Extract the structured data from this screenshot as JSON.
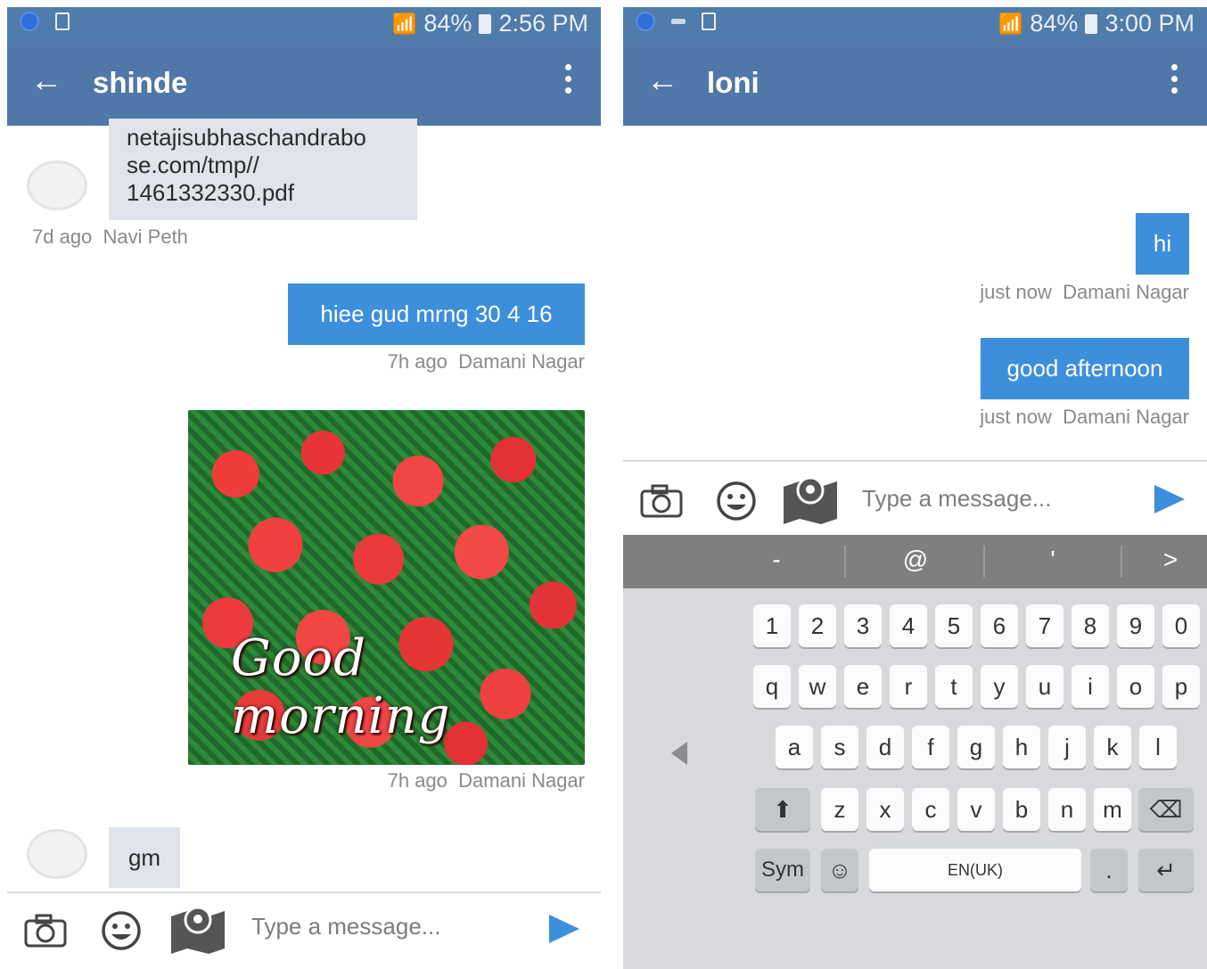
{
  "left_screen": {
    "status": {
      "battery": "84%",
      "time": "2:56 PM"
    },
    "header": {
      "back_icon": "arrow-left-icon",
      "title": "shinde",
      "menu_icon": "overflow-menu-icon"
    },
    "messages": [
      {
        "dir": "in",
        "text_lines": [
          "netajisubhaschandrabo",
          "se.com/tmp//",
          "1461332330.pdf"
        ],
        "time": "7d ago",
        "location": "Navi Peth"
      },
      {
        "dir": "out",
        "text": "hiee gud mrng 30 4 16",
        "time": "7h ago",
        "location": "Damani Nagar"
      },
      {
        "dir": "out",
        "image": "roses-image",
        "image_text": "Good morning",
        "time": "7h ago",
        "location": "Damani Nagar"
      },
      {
        "dir": "in",
        "text": "gm"
      }
    ],
    "composer": {
      "camera_icon": "camera-icon",
      "emoji_icon": "smiley-icon",
      "map_icon": "map-pin-icon",
      "placeholder": "Type a message...",
      "send_icon": "send-icon"
    }
  },
  "right_screen": {
    "status": {
      "battery": "84%",
      "time": "3:00 PM"
    },
    "header": {
      "back_icon": "arrow-left-icon",
      "title": "loni",
      "menu_icon": "overflow-menu-icon"
    },
    "messages": [
      {
        "dir": "out",
        "text": "hi",
        "time": "just now",
        "location": "Damani Nagar"
      },
      {
        "dir": "out",
        "text": "good afternoon",
        "time": "just now",
        "location": "Damani Nagar"
      }
    ],
    "composer": {
      "camera_icon": "camera-icon",
      "emoji_icon": "smiley-icon",
      "map_icon": "map-pin-icon",
      "placeholder": "Type a message...",
      "send_icon": "send-icon"
    },
    "keyboard": {
      "suggestions": [
        "-",
        "@",
        "'",
        ">"
      ],
      "row_numbers": [
        "1",
        "2",
        "3",
        "4",
        "5",
        "6",
        "7",
        "8",
        "9",
        "0"
      ],
      "row1": [
        "q",
        "w",
        "e",
        "r",
        "t",
        "y",
        "u",
        "i",
        "o",
        "p"
      ],
      "row2": [
        "a",
        "s",
        "d",
        "f",
        "g",
        "h",
        "j",
        "k",
        "l"
      ],
      "row3": [
        "z",
        "x",
        "c",
        "v",
        "b",
        "n",
        "m"
      ],
      "sym": "Sym",
      "space": "EN(UK)",
      "period": "."
    }
  },
  "colors": {
    "appbar": "#4f78a8",
    "statusbar": "#4f7cab",
    "outgoing": "#3d8fdb",
    "incoming": "#dfe4ea"
  }
}
